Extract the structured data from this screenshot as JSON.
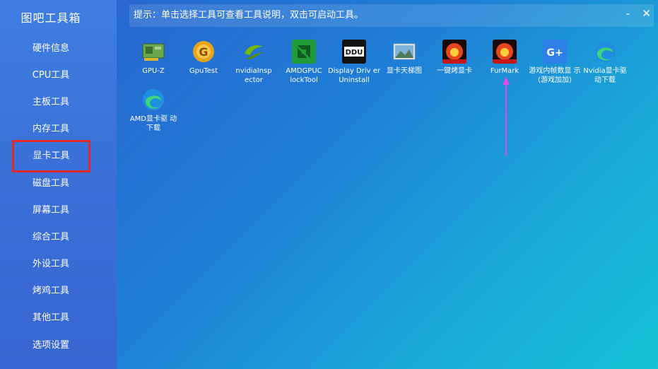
{
  "app": {
    "title": "图吧工具箱"
  },
  "sidebar": {
    "items": [
      {
        "label": "硬件信息"
      },
      {
        "label": "CPU工具"
      },
      {
        "label": "主板工具"
      },
      {
        "label": "内存工具"
      },
      {
        "label": "显卡工具",
        "selected": true
      },
      {
        "label": "磁盘工具"
      },
      {
        "label": "屏幕工具"
      },
      {
        "label": "综合工具"
      },
      {
        "label": "外设工具"
      },
      {
        "label": "烤鸡工具"
      },
      {
        "label": "其他工具"
      },
      {
        "label": "选项设置"
      }
    ]
  },
  "hint": {
    "text": "提示：单击选择工具可查看工具说明，双击可启动工具。"
  },
  "window": {
    "minimize": "-",
    "close": "✕"
  },
  "tools": [
    {
      "label": "GPU-Z",
      "icon": "gpu-card-icon"
    },
    {
      "label": "GpuTest",
      "icon": "gear-g-icon"
    },
    {
      "label": "nvidiaInsp ector",
      "icon": "nvidia-icon"
    },
    {
      "label": "AMDGPUC lockTool",
      "icon": "amd-icon"
    },
    {
      "label": "Display Driv er Uninstall",
      "icon": "ddu-icon"
    },
    {
      "label": "显卡天梯图",
      "icon": "landscape-icon"
    },
    {
      "label": "一键烤显卡",
      "icon": "furmark-icon"
    },
    {
      "label": "FurMark",
      "icon": "furmark-icon"
    },
    {
      "label": "游戏内帧数显 示(游戏加加)",
      "icon": "gplus-icon"
    },
    {
      "label": "Nvidia显卡驱 动下载",
      "icon": "edge-icon"
    },
    {
      "label": "AMD显卡驱 动下载",
      "icon": "edge-icon"
    }
  ],
  "colors": {
    "selection_outline": "#e02a2a",
    "arrow": "#d84cf0"
  }
}
